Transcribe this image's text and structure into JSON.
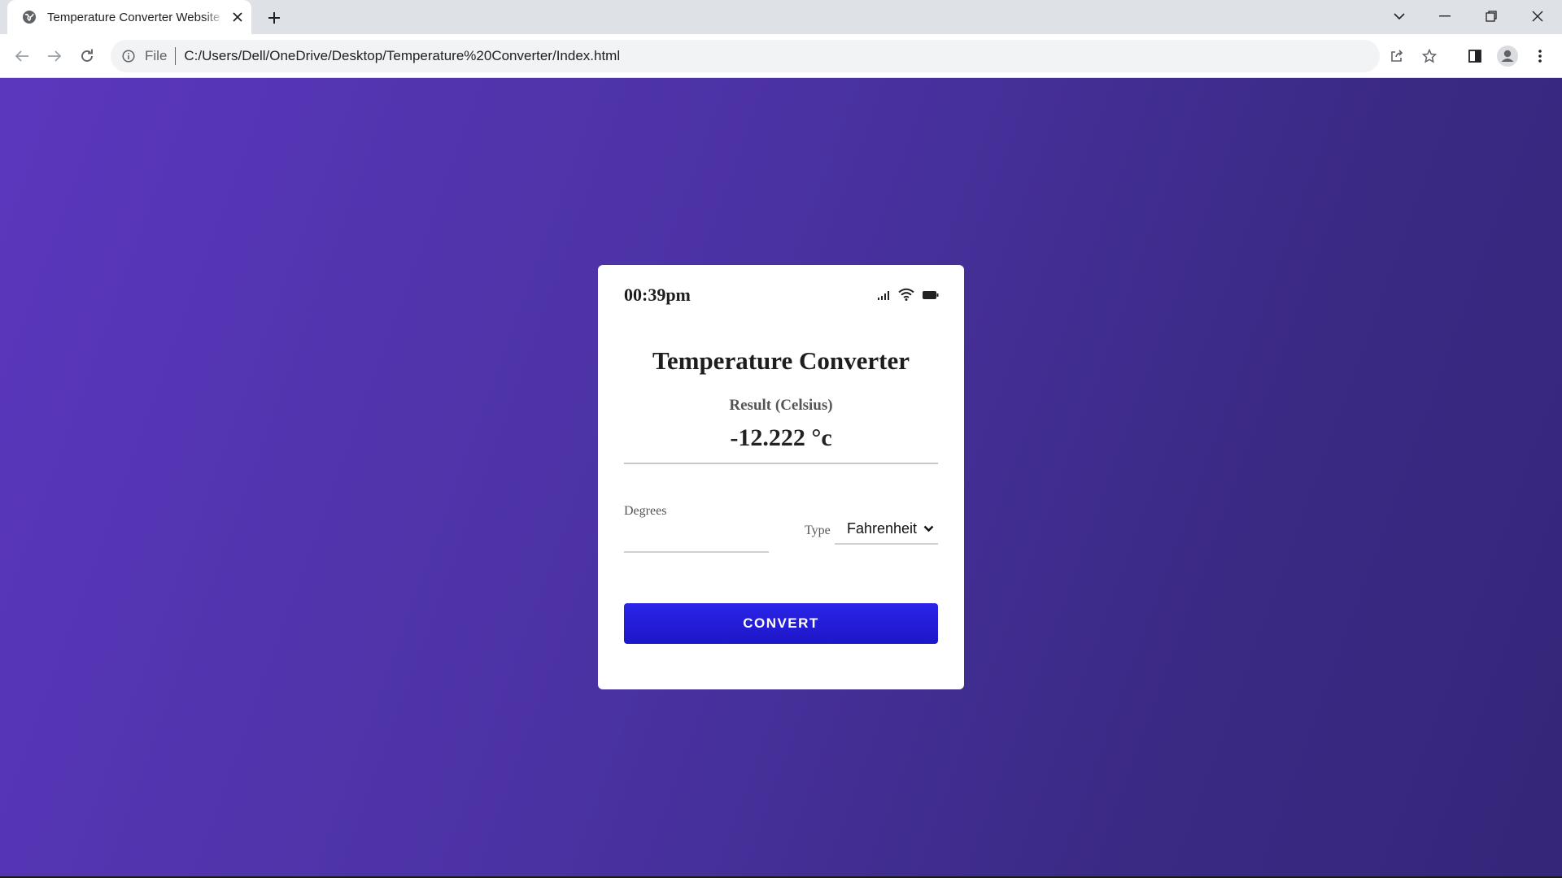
{
  "browser": {
    "tab_title": "Temperature Converter Website",
    "address_scheme": "File",
    "address_url": "C:/Users/Dell/OneDrive/Desktop/Temperature%20Converter/Index.html"
  },
  "card": {
    "status_time": "00:39pm",
    "title": "Temperature Converter",
    "result_label": "Result (Celsius)",
    "result_value": "-12.222 °c",
    "degrees_label": "Degrees",
    "degrees_value": "",
    "type_label": "Type",
    "type_selected": "Fahrenheit",
    "convert_label": "CONVERT"
  },
  "colors": {
    "page_gradient_start": "#5b37bd",
    "page_gradient_end": "#352679",
    "button": "#2520dc",
    "card_bg": "#ffffff"
  }
}
